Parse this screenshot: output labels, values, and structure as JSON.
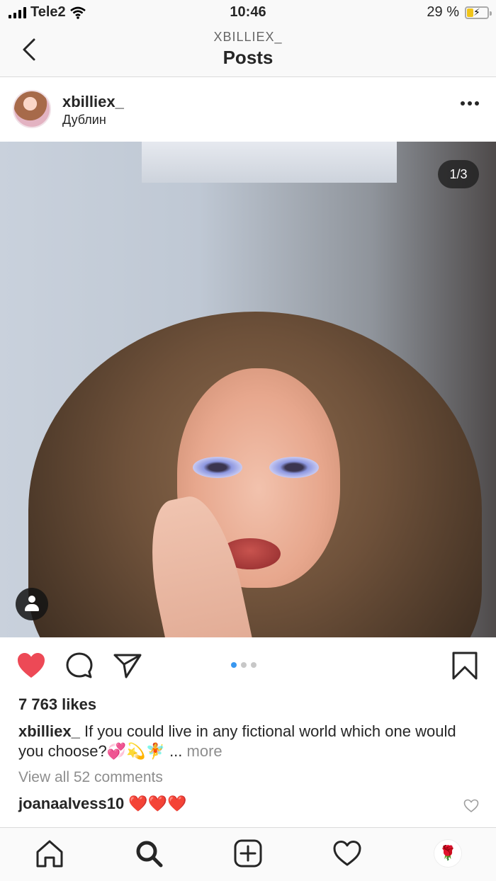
{
  "status_bar": {
    "carrier": "Tele2",
    "time": "10:46",
    "battery_percent": "29 %",
    "battery_level": 0.29
  },
  "nav": {
    "subtitle": "XBILLIEX_",
    "title": "Posts"
  },
  "post": {
    "username": "xbilliex_",
    "location": "Дублин",
    "photo_counter": "1/3",
    "carousel_index": 1,
    "carousel_total": 3,
    "liked": true,
    "likes_text": "7 763 likes",
    "caption_user": "xbilliex_",
    "caption_text": " If you could live in any fictional world which one would you choose?💞💫🧚",
    "caption_ellipsis": "... ",
    "caption_more": "more",
    "view_comments": "View all 52 comments",
    "comment_user": "joanaalvess10",
    "comment_text": " ❤️❤️❤️"
  },
  "tabs": {
    "profile_icon": "🌹"
  },
  "colors": {
    "like_red": "#ed4956",
    "dot_active": "#3897f0",
    "dot_inactive": "#c7c7c7",
    "muted_text": "#8e8e8e"
  }
}
